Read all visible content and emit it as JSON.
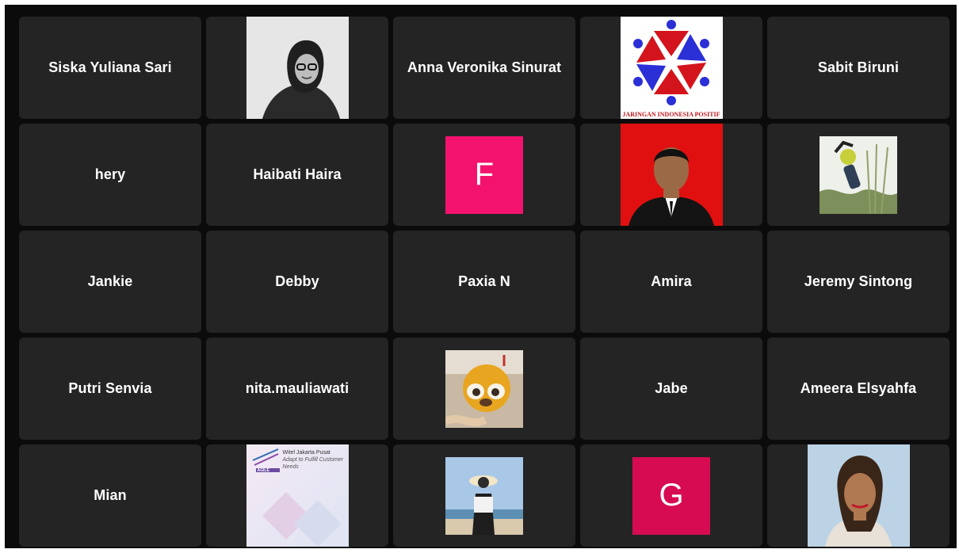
{
  "participants": [
    {
      "name": "Siska Yuliana Sari"
    },
    {
      "name": "",
      "avatar": "grayscale-portrait-photo"
    },
    {
      "name": "Anna Veronika Sinurat"
    },
    {
      "name": "",
      "avatar": "organization-logo",
      "banner": "JARINGAN INDONESIA POSITIF"
    },
    {
      "name": "Sabit Biruni"
    },
    {
      "name": "hery"
    },
    {
      "name": "Haibati Haira"
    },
    {
      "name": "",
      "initial": "F",
      "color": "#f3136e"
    },
    {
      "name": "",
      "avatar": "formal-portrait-red-background"
    },
    {
      "name": "",
      "avatar": "jumping-person-photo"
    },
    {
      "name": "Jankie"
    },
    {
      "name": "Debby"
    },
    {
      "name": "Paxia N"
    },
    {
      "name": "Amira"
    },
    {
      "name": "Jeremy Sintong"
    },
    {
      "name": "Putri Senvia"
    },
    {
      "name": "nita.mauliawati"
    },
    {
      "name": "",
      "avatar": "plush-toy-photo"
    },
    {
      "name": "Jabe"
    },
    {
      "name": "Ameera Elsyahfa"
    },
    {
      "name": "Mian"
    },
    {
      "name": "",
      "avatar": "agile-banner-image",
      "title": "Witel Jakarta Pusat",
      "subtitle": "Adapt to Fulfill Customer Needs",
      "badge": "AGILE"
    },
    {
      "name": "",
      "avatar": "beach-photo"
    },
    {
      "name": "",
      "initial": "G",
      "color": "#d60b52"
    },
    {
      "name": "",
      "avatar": "portrait-blue-background"
    }
  ]
}
